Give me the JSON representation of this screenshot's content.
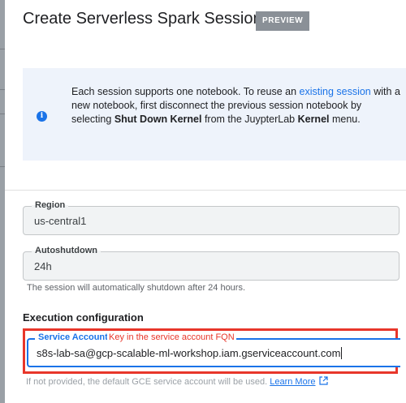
{
  "dialog": {
    "title": "Create Serverless Spark Session",
    "badge": "PREVIEW"
  },
  "info": {
    "icon": "info-icon",
    "text_before_link": "Each session supports one notebook. To reuse an ",
    "link_text": "existing session",
    "text_after_link": " with a new notebook, first disconnect the previous session notebook by selecting ",
    "bold_action": "Shut Down Kernel",
    "text_middle": " from the JuypterLab ",
    "bold_menu": "Kernel",
    "text_end": " menu."
  },
  "region": {
    "label": "Region",
    "value": "us-central1"
  },
  "autoshutdown": {
    "label": "Autoshutdown",
    "value": "24h",
    "hint": "The session will automatically shutdown after 24 hours."
  },
  "execution": {
    "heading": "Execution configuration",
    "service_account": {
      "label": "Service Account",
      "value": "s8s-lab-sa@gcp-scalable-ml-workshop.iam.gserviceaccount.com",
      "annotation": "Key in the service account FQN"
    },
    "footer_hint": "If not provided, the default GCE service account will be used.",
    "learn_more": "Learn More"
  },
  "colors": {
    "accent": "#1a73e8",
    "annotation_red": "#e8362a",
    "badge_bg": "#8a9097",
    "info_bg": "#eef3fb"
  }
}
